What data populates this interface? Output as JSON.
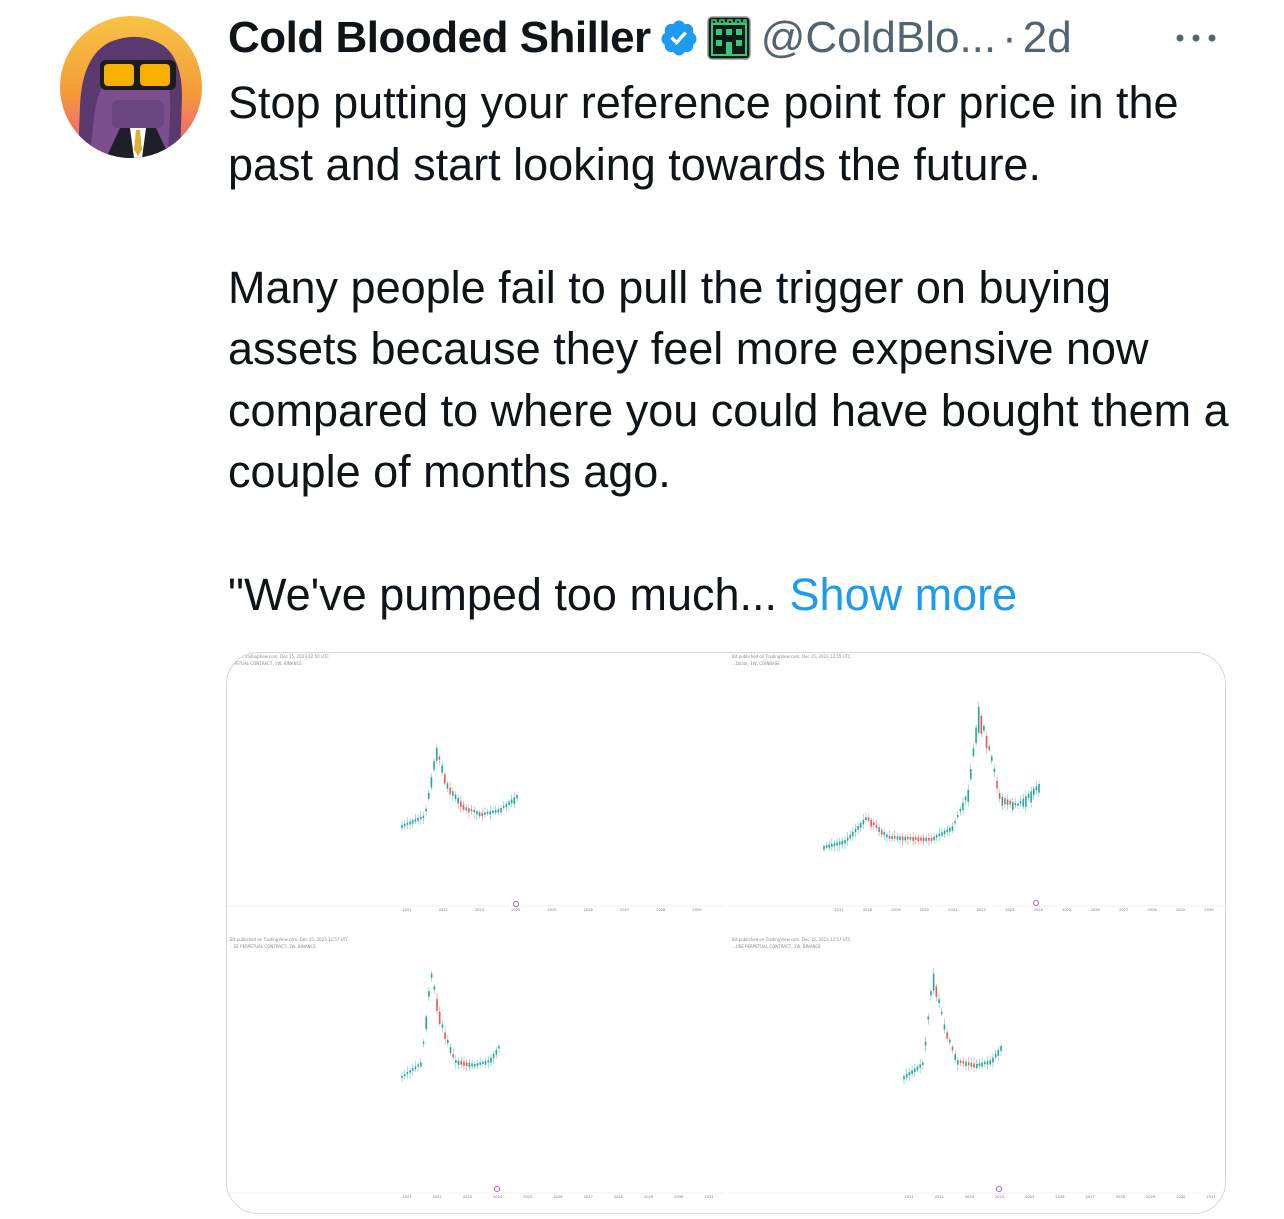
{
  "author": {
    "display_name": "Cold Blooded Shiller",
    "handle": "@ColdBlo...",
    "separator": "·",
    "time_ago": "2d",
    "avatar_icon": "avatar-purple-character-sunglasses",
    "verified_icon": "verified-badge-icon",
    "affiliation_icon": "green-building-badge-icon"
  },
  "more_icon": "more-options-icon",
  "tweet": {
    "paragraph_1": "Stop putting your reference point for price in the past and start looking towards the future.",
    "paragraph_2": "Many people fail to pull the trigger on buying assets because they feel more expensive now compared to where you could have bought them a couple of months ago.",
    "paragraph_3": "\"We've pumped too much...",
    "show_more": "Show more"
  },
  "colors": {
    "text": "#0f1419",
    "secondary": "#536471",
    "link": "#1d9bf0",
    "verified": "#1d9bf0",
    "candle_up": "#26a69a",
    "candle_down": "#ef5350"
  },
  "media": {
    "images": [
      {
        "header_line_1": "...d on TradingView.com, Dec 15, 2023 12:50 UTC",
        "header_line_2": "...PETUAL CONTRACT, 1W, BINANCE",
        "tick_labels": [
          "2021",
          "2022",
          "2023",
          "2024",
          "2025",
          "2026",
          "2027",
          "2028",
          "2029"
        ]
      },
      {
        "header_line_1": "Bit published on TradingView.com, Dec 15, 2023 12:55 UTC",
        "header_line_2": "...Dollar, 1W, COINBASE",
        "tick_labels": [
          "2017",
          "2018",
          "2019",
          "2020",
          "2021",
          "2022",
          "2023",
          "2024",
          "2025",
          "2026",
          "2027",
          "2028",
          "2029",
          "2030"
        ]
      },
      {
        "header_line_1": "Bit published on TradingView.com, Dec 15, 2023 12:57 UTC",
        "header_line_2": "...SE PERPETUAL CONTRACT, 1W, BINANCE",
        "tick_labels": [
          "2021",
          "2022",
          "2023",
          "2024",
          "2025",
          "2026",
          "2027",
          "2028",
          "2029",
          "2030",
          "2031"
        ]
      },
      {
        "header_line_1": "Bit published on TradingView.com, Dec 15, 2023 12:57 UTC",
        "header_line_2": "...USE PERPETUAL CONTRACT, 1W, BINANCE",
        "tick_labels": [
          "2021",
          "2022",
          "2023",
          "2024",
          "2025",
          "2026",
          "2027",
          "2028",
          "2029",
          "2030",
          "2031"
        ]
      }
    ]
  }
}
